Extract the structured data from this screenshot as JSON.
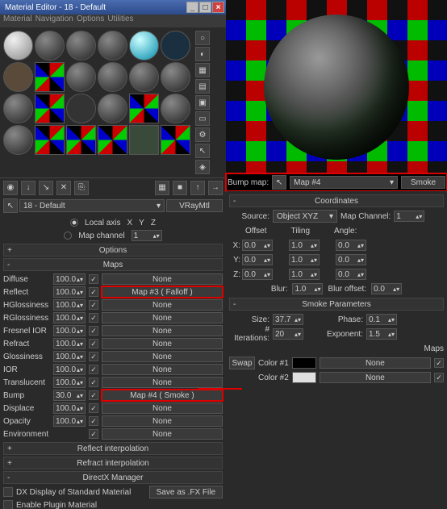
{
  "titlebar": {
    "title": "Material Editor - 18 - Default"
  },
  "menu": {
    "material": "Material",
    "navigation": "Navigation",
    "options": "Options",
    "utilities": "Utilities"
  },
  "picker": {
    "slot": "18 - Default",
    "type": "VRayMtl"
  },
  "localaxis": {
    "label": "Local axis",
    "x": "X",
    "y": "Y",
    "z": "Z"
  },
  "mapchannel": {
    "label": "Map channel",
    "value": "1"
  },
  "rollouts": {
    "options": "Options",
    "maps": "Maps",
    "reflinterp": "Reflect interpolation",
    "refrinterp": "Refract interpolation",
    "dxmgr": "DirectX Manager",
    "coords": "Coordinates",
    "smoke": "Smoke Parameters",
    "mapsr": "Maps"
  },
  "maps": {
    "diffuse": {
      "label": "Diffuse",
      "val": "100.0",
      "btn": "None"
    },
    "reflect": {
      "label": "Reflect",
      "val": "100.0",
      "btn": "Map #3  ( Falloff )"
    },
    "hgloss": {
      "label": "HGlossiness",
      "val": "100.0",
      "btn": "None"
    },
    "rgloss": {
      "label": "RGlossiness",
      "val": "100.0",
      "btn": "None"
    },
    "fresnel": {
      "label": "Fresnel IOR",
      "val": "100.0",
      "btn": "None"
    },
    "refract": {
      "label": "Refract",
      "val": "100.0",
      "btn": "None"
    },
    "gloss": {
      "label": "Glossiness",
      "val": "100.0",
      "btn": "None"
    },
    "ior": {
      "label": "IOR",
      "val": "100.0",
      "btn": "None"
    },
    "trans": {
      "label": "Translucent",
      "val": "100.0",
      "btn": "None"
    },
    "bump": {
      "label": "Bump",
      "val": "30.0",
      "btn": "Map #4  ( Smoke )"
    },
    "displace": {
      "label": "Displace",
      "val": "100.0",
      "btn": "None"
    },
    "opacity": {
      "label": "Opacity",
      "val": "100.0",
      "btn": "None"
    },
    "env": {
      "label": "Environment",
      "btn": "None"
    }
  },
  "dx": {
    "opt1": "DX Display of Standard Material",
    "save": "Save as .FX File",
    "opt2": "Enable Plugin Material"
  },
  "bumpbar": {
    "label": "Bump map:",
    "map": "Map #4",
    "type": "Smoke"
  },
  "coords": {
    "source_label": "Source:",
    "source": "Object XYZ",
    "mapch_label": "Map Channel:",
    "mapch": "1",
    "hdr_offset": "Offset",
    "hdr_tiling": "Tiling",
    "hdr_angle": "Angle:",
    "x": "X:",
    "y": "Y:",
    "z": "Z:",
    "xo": "0.0",
    "yo": "0.0",
    "zo": "0.0",
    "xt": "1.0",
    "yt": "1.0",
    "zt": "1.0",
    "xa": "0.0",
    "ya": "0.0",
    "za": "0.0",
    "blur_label": "Blur:",
    "blur": "1.0",
    "bluroff_label": "Blur offset:",
    "bluroff": "0.0"
  },
  "smoke": {
    "size_label": "Size:",
    "size": "37.7",
    "phase_label": "Phase:",
    "phase": "0.1",
    "iter_label": "# Iterations:",
    "iter": "20",
    "exp_label": "Exponent:",
    "exp": "1.5",
    "swap": "Swap",
    "col1_label": "Color #1",
    "col2_label": "Color #2",
    "none": "None"
  }
}
